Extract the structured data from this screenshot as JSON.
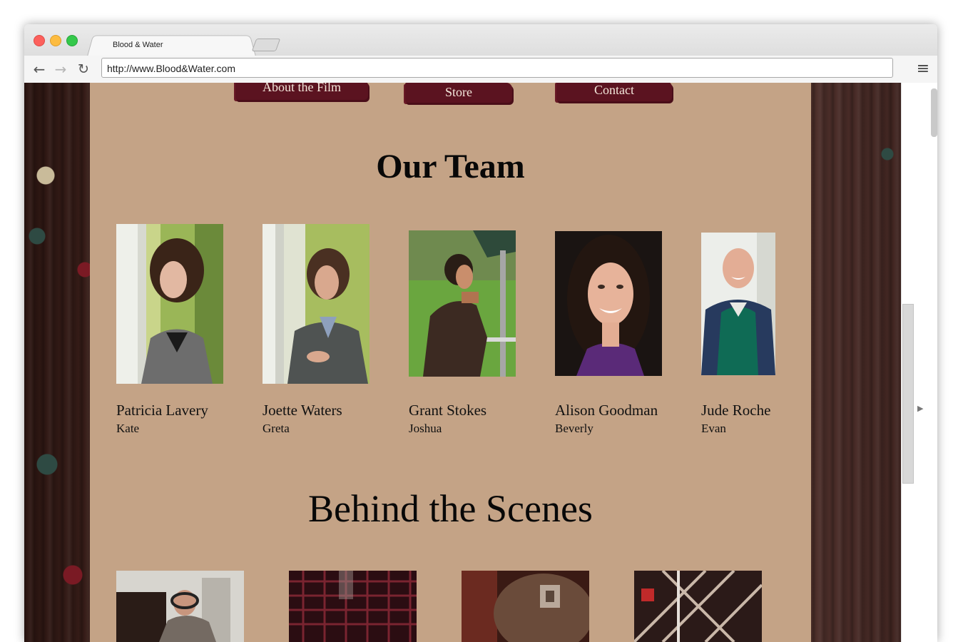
{
  "browser": {
    "tab_title": "Blood & Water",
    "url": "http://www.Blood&Water.com",
    "back_icon": "back-arrow-icon",
    "forward_icon": "forward-arrow-icon",
    "reload_icon": "reload-icon",
    "menu_icon": "hamburger-menu-icon"
  },
  "site": {
    "nav": [
      "About the Film",
      "Store",
      "Contact"
    ],
    "team_heading": "Our Team",
    "team": [
      {
        "name": "Patricia Lavery",
        "role": "Kate"
      },
      {
        "name": "Joette Waters",
        "role": "Greta"
      },
      {
        "name": "Grant Stokes",
        "role": "Joshua"
      },
      {
        "name": "Alison Goodman",
        "role": "Beverly"
      },
      {
        "name": "Jude Roche",
        "role": "Evan"
      }
    ],
    "behind_heading": "Behind the Scenes"
  },
  "colors": {
    "page_bg": "#c4a386",
    "nav_button": "#5b1320",
    "wood": "#3a201c"
  }
}
